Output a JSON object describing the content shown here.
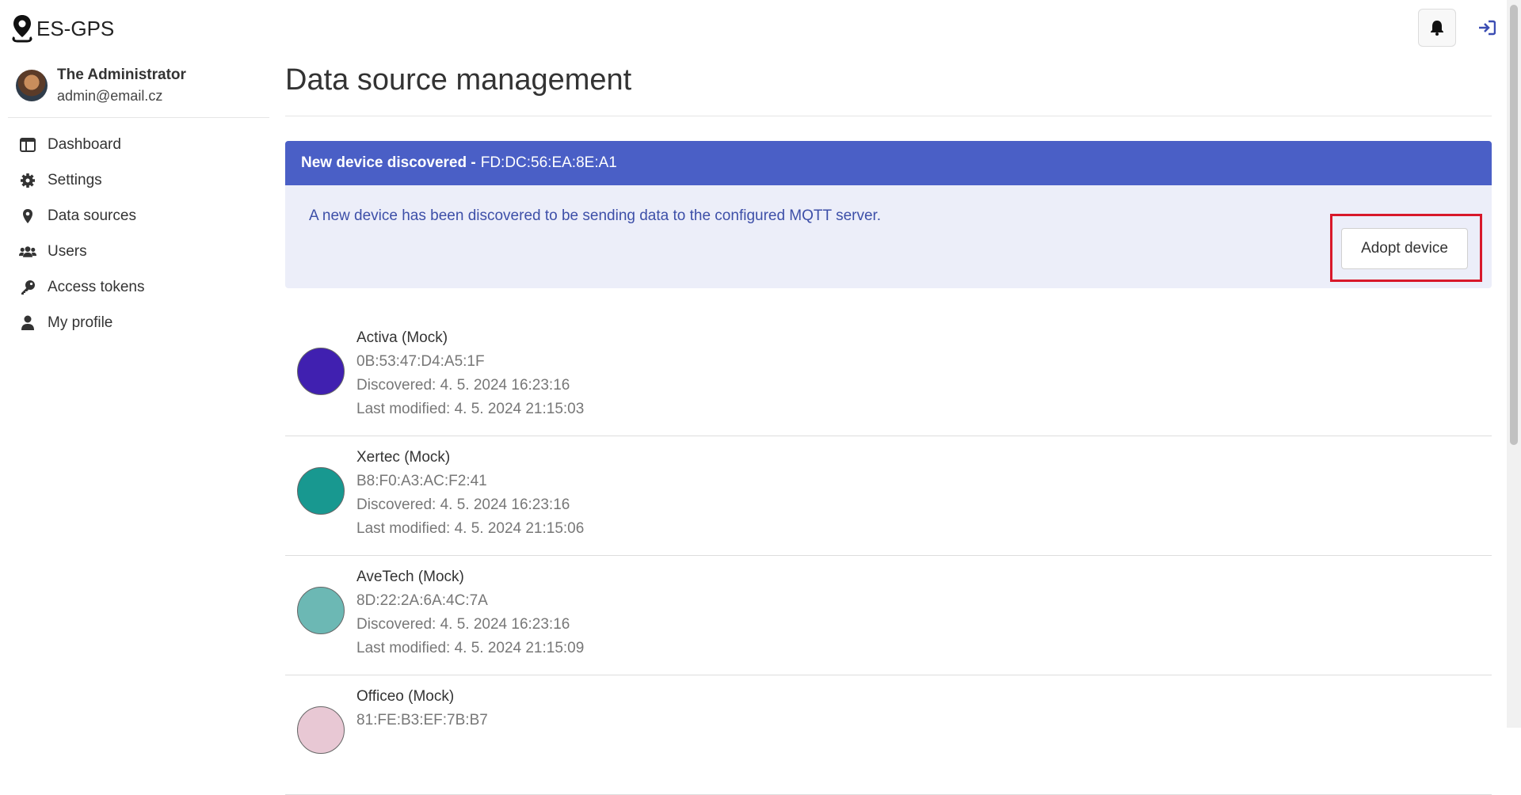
{
  "app": {
    "title": "ES-GPS"
  },
  "user": {
    "name": "The Administrator",
    "email": "admin@email.cz"
  },
  "nav": [
    {
      "label": "Dashboard",
      "icon": "dashboard-icon"
    },
    {
      "label": "Settings",
      "icon": "gear-icon"
    },
    {
      "label": "Data sources",
      "icon": "map-marker-icon"
    },
    {
      "label": "Users",
      "icon": "users-icon"
    },
    {
      "label": "Access tokens",
      "icon": "key-icon"
    },
    {
      "label": "My profile",
      "icon": "user-icon"
    }
  ],
  "page": {
    "title": "Data source management"
  },
  "alert": {
    "heading": "New device discovered -",
    "mac": "FD:DC:56:EA:8E:A1",
    "message": "A new device has been discovered to be sending data to the configured MQTT server.",
    "button": "Adopt device"
  },
  "devices": [
    {
      "name": "Activa (Mock)",
      "mac": "0B:53:47:D4:A5:1F",
      "discovered": "Discovered: 4. 5. 2024 16:23:16",
      "modified": "Last modified: 4. 5. 2024 21:15:03",
      "color": "#4020b0"
    },
    {
      "name": "Xertec (Mock)",
      "mac": "B8:F0:A3:AC:F2:41",
      "discovered": "Discovered: 4. 5. 2024 16:23:16",
      "modified": "Last modified: 4. 5. 2024 21:15:06",
      "color": "#189890"
    },
    {
      "name": "AveTech (Mock)",
      "mac": "8D:22:2A:6A:4C:7A",
      "discovered": "Discovered: 4. 5. 2024 16:23:16",
      "modified": "Last modified: 4. 5. 2024 21:15:09",
      "color": "#6cb8b4"
    },
    {
      "name": "Officeo (Mock)",
      "mac": "81:FE:B3:EF:7B:B7",
      "discovered": "",
      "modified": "",
      "color": "#e8c8d4"
    }
  ],
  "colors": {
    "accent": "#4a5fc6",
    "highlight": "#d8182a"
  }
}
